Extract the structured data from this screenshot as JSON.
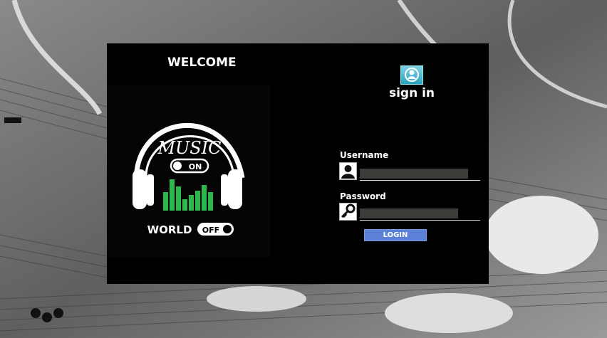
{
  "left": {
    "welcome": "WELCOME",
    "logo": {
      "top_word": "MUSIC",
      "on_label": "ON",
      "bottom_word": "WORLD",
      "off_label": "OFF",
      "equalizer_color": "#2fb84a"
    }
  },
  "right": {
    "icon": "user-avatar-icon",
    "title": "sign in",
    "username_label": "Username",
    "username_value": "",
    "password_label": "Password",
    "password_value": "",
    "login_label": "LOGIN"
  },
  "colors": {
    "panel": "#000000",
    "field": "#3a3d38",
    "button": "#5b80d6"
  }
}
